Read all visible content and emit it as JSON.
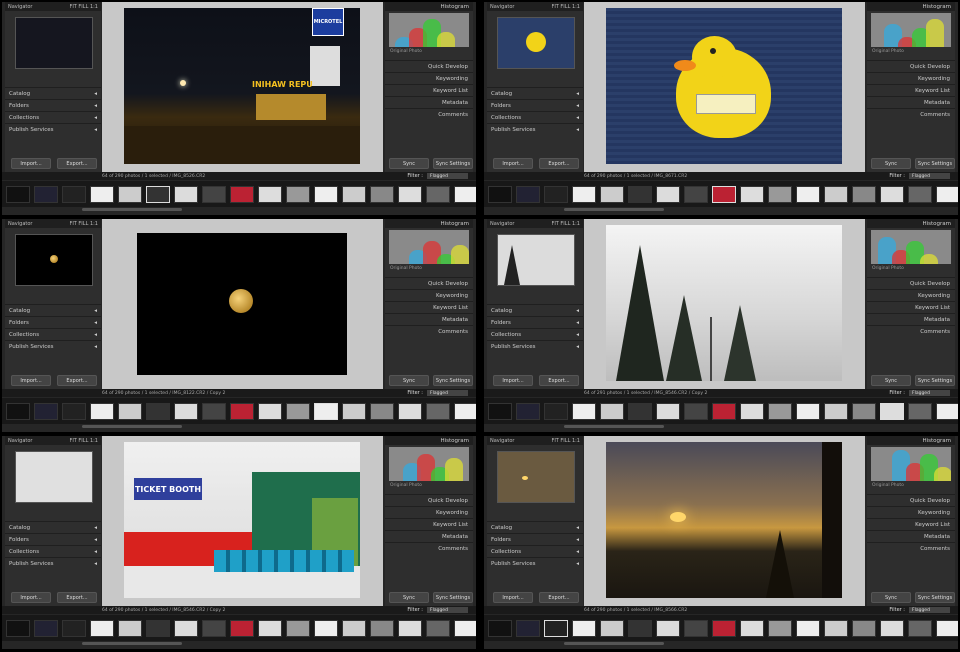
{
  "panels": [
    {
      "photo": "night-hotel",
      "info": "64 of 290 photos / 1 selected / IMG_8526.CR2"
    },
    {
      "photo": "duck",
      "info": "64 of 290 photos / 1 selected / IMG_8671.CR2"
    },
    {
      "photo": "moon",
      "info": "64 of 290 photos / 1 selected / IMG_8122.CR2 / Copy 2"
    },
    {
      "photo": "pines",
      "info": "64 of 291 photos / 1 selected / IMG_8546.CR2 / Copy 2"
    },
    {
      "photo": "ticket",
      "info": "64 of 290 photos / 1 selected / IMG_8546.CR2 / Copy 2"
    },
    {
      "photo": "sunrise",
      "info": "64 of 290 photos / 1 selected / IMG_8566.CR2"
    }
  ],
  "labels": {
    "navigator": "Navigator",
    "histogram": "Histogram",
    "original_photo": "Original Photo",
    "left_sections": [
      "Catalog",
      "Folders",
      "Collections",
      "Publish Services"
    ],
    "right_sections": [
      "Quick Develop",
      "Keywording",
      "Keyword List",
      "Metadata",
      "Comments"
    ],
    "import": "Import...",
    "export": "Export...",
    "sync": "Sync",
    "sync_settings": "Sync Settings",
    "filter": "Filter :",
    "flagged": "Flagged"
  },
  "photo_text": {
    "hotel_sign": "MICROTEL",
    "inihaw": "INIHAW REPU",
    "ticket_booth": "TICKET BOOTH"
  },
  "colors": {
    "bg": "#000000",
    "panel": "#2e2e2e",
    "center": "#c8c8c8",
    "accent_yellow": "#f2d318",
    "booth_blue": "#2f3f9c"
  }
}
